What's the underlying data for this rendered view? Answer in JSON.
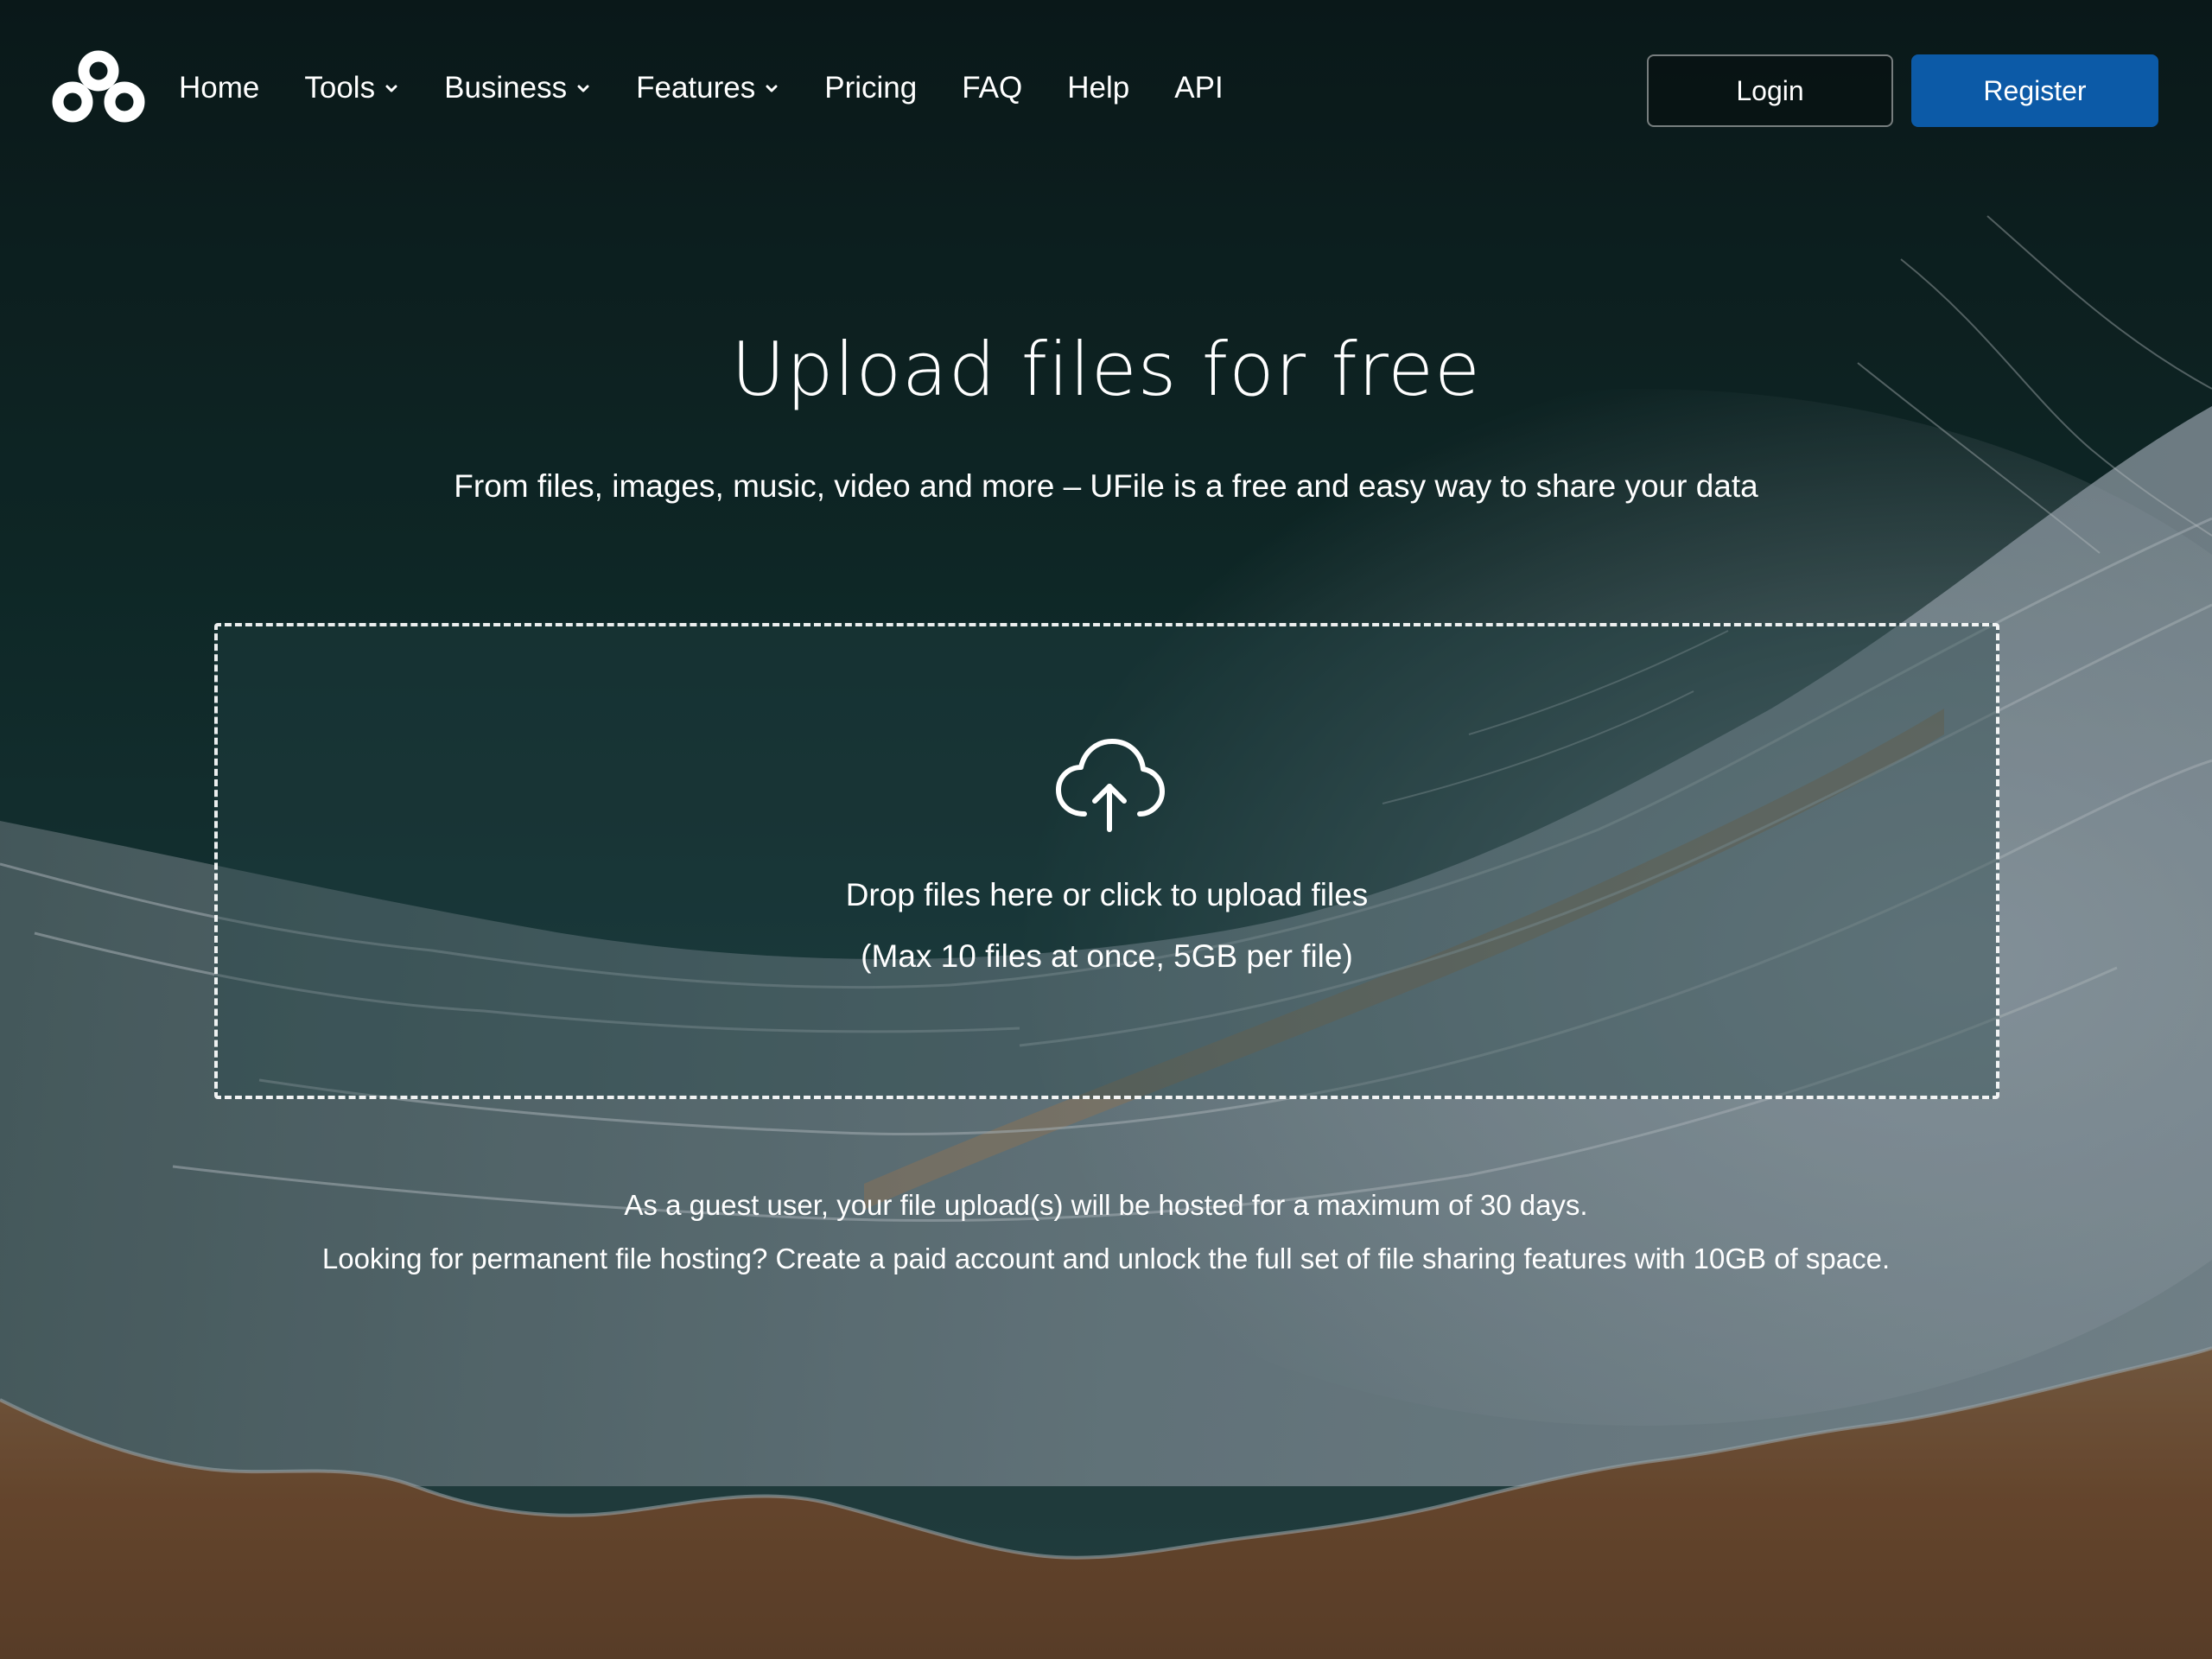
{
  "nav": {
    "items": [
      {
        "label": "Home",
        "has_dropdown": false
      },
      {
        "label": "Tools",
        "has_dropdown": true
      },
      {
        "label": "Business",
        "has_dropdown": true
      },
      {
        "label": "Features",
        "has_dropdown": true
      },
      {
        "label": "Pricing",
        "has_dropdown": false
      },
      {
        "label": "FAQ",
        "has_dropdown": false
      },
      {
        "label": "Help",
        "has_dropdown": false
      },
      {
        "label": "API",
        "has_dropdown": false
      }
    ],
    "login_label": "Login",
    "register_label": "Register"
  },
  "hero": {
    "title": "Upload files for free",
    "subtitle": "From files, images, music, video and more – UFile is a free and easy way to share your data"
  },
  "dropzone": {
    "icon": "cloud-upload-icon",
    "text": "Drop files here or click to upload files",
    "limit": "(Max 10 files at once, 5GB per file)"
  },
  "notes": {
    "guest": "As a guest user, your file upload(s) will be hosted for a maximum of 30 days.",
    "upsell": "Looking for permanent file hosting? Create a paid account and unlock the full set of file sharing features with 10GB of space."
  },
  "colors": {
    "register_button": "#0c5aa7",
    "ocean_dark": "#0f2526",
    "sand": "#7a5638"
  }
}
